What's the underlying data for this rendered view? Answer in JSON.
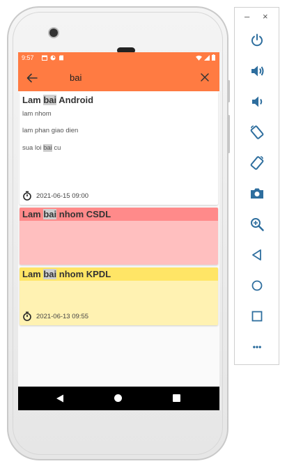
{
  "statusbar": {
    "time": "9:57"
  },
  "appbar": {
    "search_query": "bai"
  },
  "notes": [
    {
      "title_parts": [
        "Lam ",
        "bai",
        " Android"
      ],
      "lines": [
        {
          "parts": [
            "lam nhom"
          ]
        },
        {
          "parts": [
            "lam phan giao dien"
          ]
        },
        {
          "parts": [
            "sua loi ",
            "bai",
            " cu"
          ]
        }
      ],
      "date": "2021-06-15 09:00",
      "color": "#ffffff"
    },
    {
      "title_parts": [
        "Lam ",
        "bai",
        " nhom CSDL"
      ],
      "color": "#ffbfbf",
      "title_bar_color": "#ff8a8a"
    },
    {
      "title_parts": [
        "Lam ",
        "bai",
        " nhom KPDL"
      ],
      "date": "2021-06-13 09:55",
      "color": "#fff2b2",
      "title_bar_color": "#ffe566"
    }
  ],
  "colors": {
    "accent": "#ff7b42",
    "highlight": "#cfcfcf"
  },
  "toolbar": {
    "window_minimize": "–",
    "window_close": "×",
    "buttons": [
      {
        "icon": "power-icon"
      },
      {
        "icon": "volume-up-icon"
      },
      {
        "icon": "volume-down-icon"
      },
      {
        "icon": "rotate-left-icon"
      },
      {
        "icon": "rotate-right-icon"
      },
      {
        "icon": "camera-icon"
      },
      {
        "icon": "zoom-icon"
      },
      {
        "icon": "back-icon"
      },
      {
        "icon": "home-icon"
      },
      {
        "icon": "overview-icon"
      },
      {
        "icon": "more-icon"
      }
    ],
    "more_label": "•••"
  }
}
